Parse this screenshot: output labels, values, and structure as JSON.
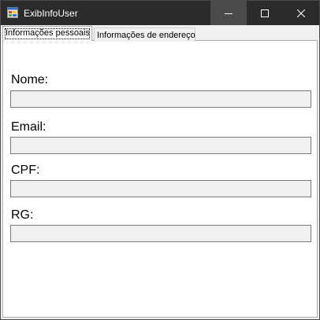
{
  "window": {
    "title": "ExibInfoUser"
  },
  "tabs": [
    {
      "label": "Informações pessoais",
      "active": true
    },
    {
      "label": "Informações de endereço",
      "active": false
    }
  ],
  "fields": [
    {
      "label": "Nome:",
      "value": ""
    },
    {
      "label": "Email:",
      "value": ""
    },
    {
      "label": "CPF:",
      "value": ""
    },
    {
      "label": "RG:",
      "value": ""
    }
  ],
  "colors": {
    "titlebar": "#2b2b2b",
    "input_background": "#f0f0f0",
    "input_border": "#7a7a7a"
  },
  "icons": [
    "app-form-icon",
    "minimize-icon",
    "maximize-icon",
    "close-icon"
  ]
}
